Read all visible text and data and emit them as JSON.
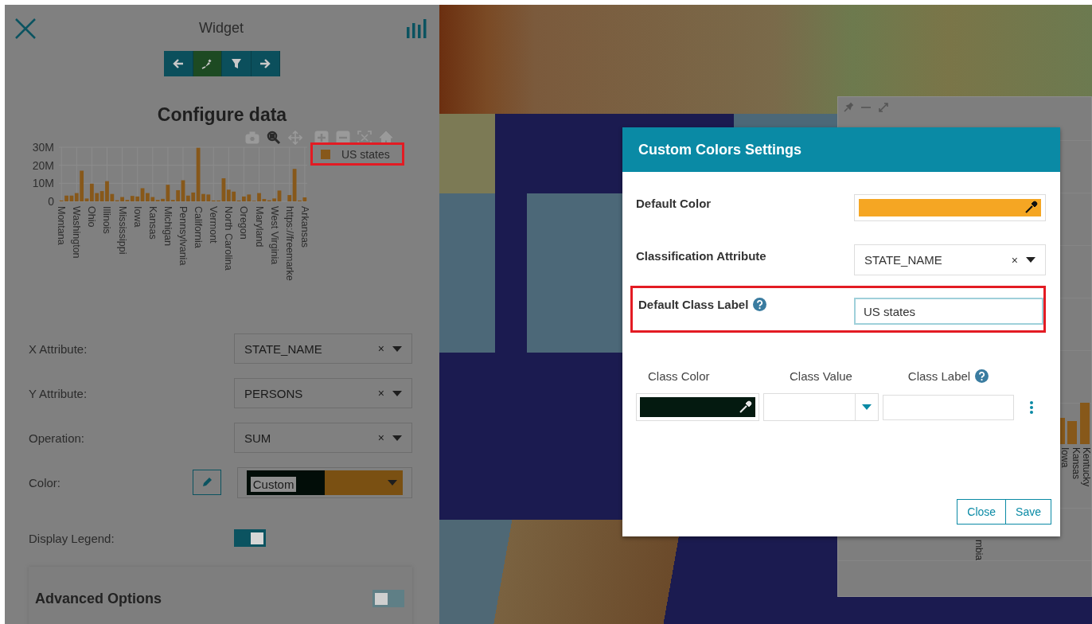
{
  "panel": {
    "title": "Widget",
    "nav_buttons": [
      {
        "kind": "back",
        "selected": false
      },
      {
        "kind": "plug",
        "selected": true
      },
      {
        "kind": "filter",
        "selected": false
      },
      {
        "kind": "forward",
        "selected": false
      }
    ],
    "heading": "Configure data",
    "chart_toolbar": [
      {
        "kind": "camera",
        "selected": false
      },
      {
        "kind": "zoom",
        "selected": true
      },
      {
        "kind": "pan",
        "selected": false
      },
      {
        "kind": "zoom-in",
        "selected": false
      },
      {
        "kind": "zoom-out",
        "selected": false
      },
      {
        "kind": "autoscale",
        "selected": false
      },
      {
        "kind": "home",
        "selected": false
      }
    ],
    "chart": {
      "legend": {
        "highlighted": true
      },
      "chart_data": {
        "type": "bar",
        "categories": [
          "Montana",
          null,
          null,
          "Washington",
          null,
          null,
          "Ohio",
          null,
          null,
          "Illinois",
          null,
          null,
          "Mississippi",
          null,
          null,
          "Iowa",
          null,
          null,
          "Kansas",
          null,
          null,
          "Michigan",
          null,
          null,
          "Pennsylvania",
          null,
          null,
          "California",
          null,
          null,
          "Vermont",
          null,
          null,
          "North Carolina",
          null,
          null,
          "Oregon",
          null,
          null,
          "Maryland",
          null,
          null,
          "West Virginia",
          null,
          null,
          "https://freemarke",
          null,
          null,
          "Arkansas"
        ],
        "series": [
          {
            "name": "US states",
            "color": "#87581a",
            "values": [
              500000,
              3200000,
              3200000,
              4600000,
              17000000,
              1600000,
              9800000,
              4600000,
              5700000,
              11200000,
              4100000,
              600000,
              2400000,
              800000,
              3000000,
              2700000,
              7300000,
              4600000,
              2400000,
              800000,
              1400000,
              9200000,
              800000,
              6200000,
              11700000,
              3200000,
              4900000,
              29700000,
              4100000,
              3800000,
              500000,
              500000,
              12800000,
              6500000,
              5400000,
              500000,
              2700000,
              3800000,
              300000,
              4600000,
              1300000,
              600000,
              1600000,
              6000000,
              null,
              3500000,
              18000000,
              500000,
              2200000
            ]
          }
        ],
        "ylim": [
          0,
          30000000
        ],
        "grid": true,
        "yticks": [
          {
            "value": 0,
            "label": "0"
          },
          {
            "value": 10000000,
            "label": "10M"
          },
          {
            "value": 20000000,
            "label": "20M"
          },
          {
            "value": 30000000,
            "label": "30M"
          }
        ]
      }
    },
    "fields": [
      {
        "kind": "select",
        "label": "X Attribute:",
        "value": "STATE_NAME",
        "clear": "×"
      },
      {
        "kind": "select",
        "label": "Y Attribute:",
        "value": "PERSONS",
        "clear": "×"
      },
      {
        "kind": "select",
        "label": "Operation:",
        "value": "SUM",
        "clear": "×"
      },
      {
        "kind": "color",
        "label": "Color:",
        "value": "Custom",
        "swatches": [
          {
            "color": "#020d08"
          },
          {
            "color": "#7a5012"
          }
        ]
      }
    ],
    "display_legend": {
      "label": "Display Legend:",
      "on": true
    },
    "advanced": {
      "title": "Advanced Options",
      "on": false
    }
  },
  "back_window": {
    "axis_labels": [
      "mbia",
      "Iowa",
      "Kansas",
      "Kentucky"
    ]
  },
  "dialog": {
    "title": "Custom Colors Settings",
    "default_color": {
      "label": "Default Color",
      "color": "#f5a623"
    },
    "classification": {
      "label": "Classification Attribute",
      "value": "STATE_NAME",
      "clear": "×"
    },
    "default_class_label": {
      "label": "Default Class Label",
      "value": "US states",
      "highlighted": true
    },
    "class_columns": [
      "Class Color",
      "Class Value",
      "Class Label"
    ],
    "class_rows": [
      {
        "color": "#041a10"
      }
    ],
    "buttons": [
      "Close",
      "Save"
    ]
  }
}
